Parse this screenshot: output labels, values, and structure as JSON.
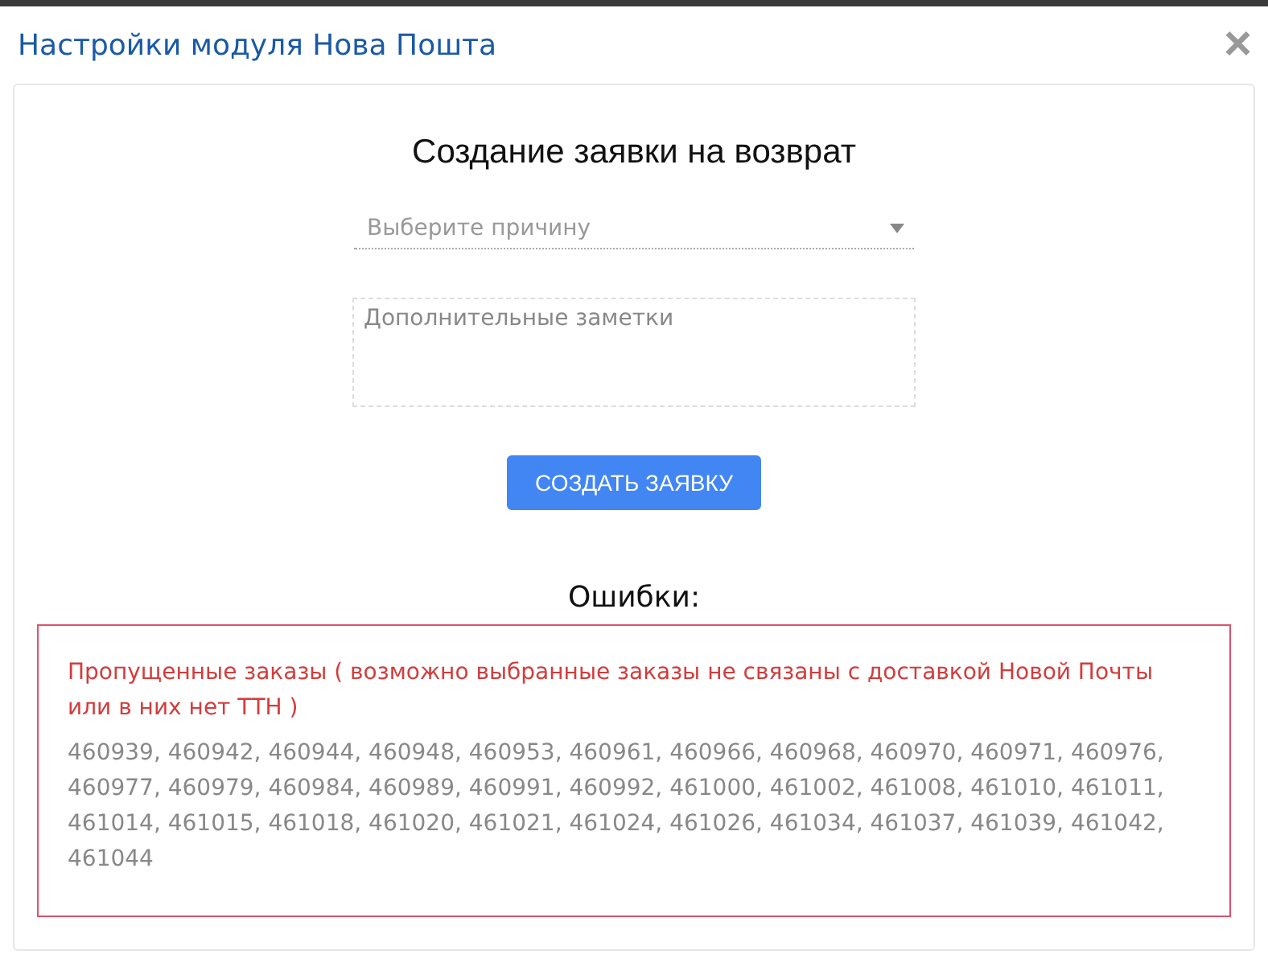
{
  "window": {
    "title": "Настройки модуля Нова Пошта",
    "close": "×"
  },
  "form": {
    "heading": "Создание заявки на возврат",
    "reason_select": {
      "placeholder": "Выберите причину"
    },
    "notes": {
      "placeholder": "Дополнительные заметки"
    },
    "submit_button": "СОЗДАТЬ ЗАЯВКУ"
  },
  "errors": {
    "heading": "Ошибки:",
    "message": "Пропущенные заказы ( возможно выбранные заказы не связаны с доставкой Новой Почты или в них нет ТТН )",
    "orders": "460939, 460942, 460944, 460948, 460953, 460961, 460966, 460968, 460970, 460971, 460976, 460977, 460979, 460984, 460989, 460991, 460992, 461000, 461002, 461008, 461010, 461011, 461014, 461015, 461018, 461020, 461021, 461024, 461026, 461034, 461037, 461039, 461042, 461044"
  }
}
